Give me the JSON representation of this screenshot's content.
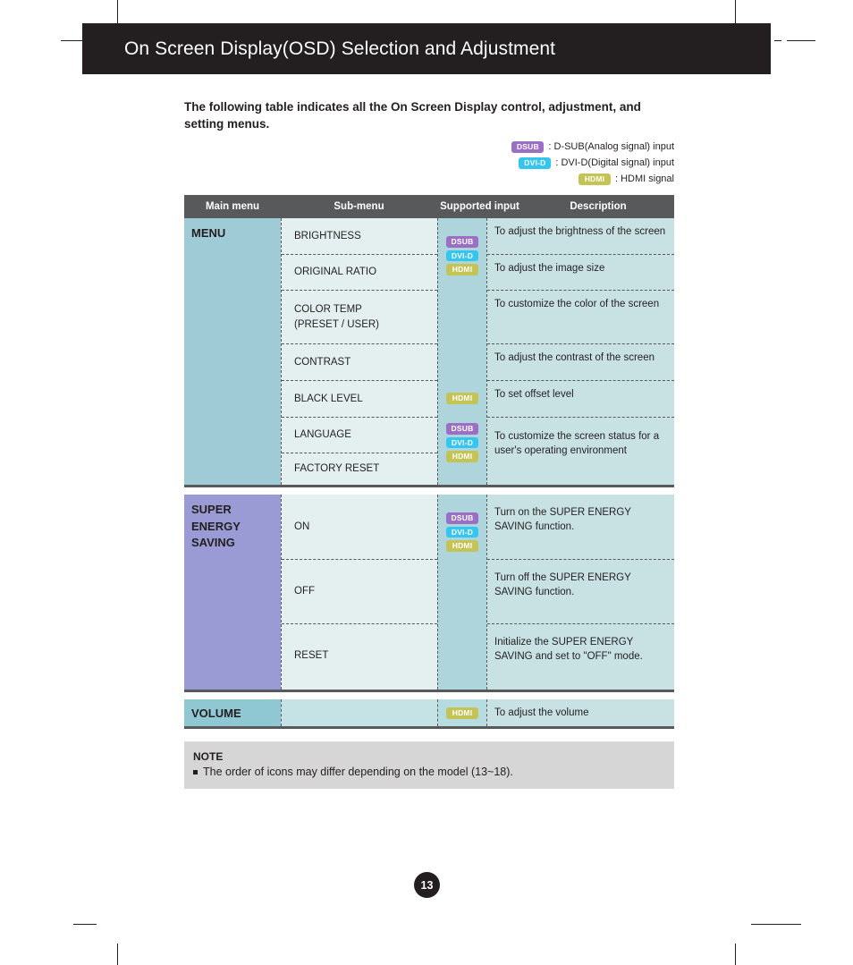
{
  "header": {
    "title": "On Screen Display(OSD) Selection and Adjustment"
  },
  "intro": {
    "text": "The following table indicates all the On Screen Display control, adjustment, and setting menus."
  },
  "legend": {
    "items": [
      {
        "badge": "DSUB",
        "badge_color": "#9b6fc4",
        "text": ": D-SUB(Analog signal) input"
      },
      {
        "badge": "DVI-D",
        "badge_color": "#35c6f0",
        "text": ": DVI-D(Digital signal) input"
      },
      {
        "badge": "HDMI",
        "badge_color": "#c3c455",
        "text": ": HDMI signal"
      }
    ]
  },
  "table": {
    "headers": {
      "main": "Main menu",
      "sub": "Sub-menu",
      "input": "Supported input",
      "desc": "Description"
    },
    "sections": [
      {
        "main": "MENU",
        "main_color": "#9fcbd7",
        "submenus": [
          "BRIGHTNESS",
          "ORIGINAL RATIO",
          "COLOR TEMP\n(PRESET / USER)",
          "CONTRAST",
          "BLACK LEVEL",
          "LANGUAGE",
          "FACTORY RESET"
        ],
        "inputs": [
          {
            "badges": [
              "DSUB",
              "DVI-D",
              "HDMI"
            ]
          },
          {
            "badges": [
              "HDMI"
            ]
          },
          {
            "badges": [
              "DSUB",
              "DVI-D",
              "HDMI"
            ]
          }
        ],
        "descriptions": [
          "To adjust the brightness of the screen",
          "To adjust the image size",
          "To customize the color of the screen",
          "To adjust the contrast of the screen",
          "To set offset level",
          "To customize the screen status for a user's operating environment"
        ]
      },
      {
        "main": "SUPER ENERGY SAVING",
        "main_color": "#9a9bd4",
        "submenus": [
          "ON",
          "OFF",
          "RESET"
        ],
        "inputs": [
          {
            "badges": [
              "DSUB",
              "DVI-D",
              "HDMI"
            ]
          }
        ],
        "descriptions": [
          "Turn on the SUPER ENERGY SAVING function.",
          "Turn off the SUPER ENERGY SAVING function.",
          "Initialize the SUPER ENERGY SAVING and set to \"OFF\" mode."
        ]
      }
    ],
    "volume_row": {
      "main": "VOLUME",
      "badge": "HDMI",
      "desc": "To adjust the volume"
    }
  },
  "note": {
    "title": "NOTE",
    "items": [
      "The order of icons may differ depending on the model (13~18)."
    ]
  },
  "page_number": "13"
}
